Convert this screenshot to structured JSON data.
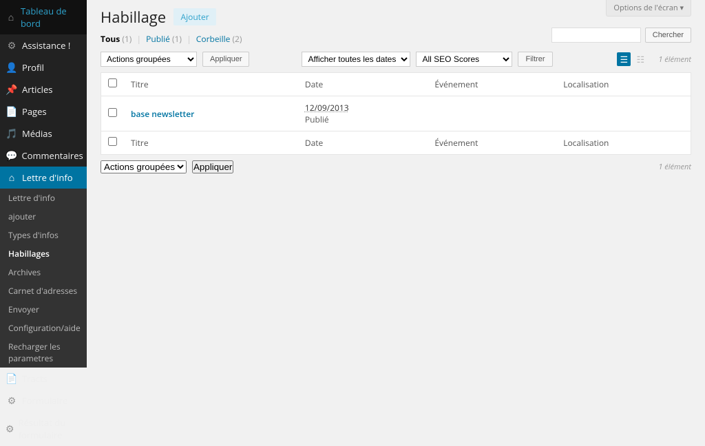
{
  "screenOptions": {
    "label": "Options de l'écran"
  },
  "sidebar": {
    "items": [
      {
        "label": "Tableau de bord",
        "icon": "dashboard"
      },
      {
        "label": "Assistance !",
        "icon": "gear"
      },
      {
        "label": "Profil",
        "icon": "user"
      },
      {
        "label": "Articles",
        "icon": "pin"
      },
      {
        "label": "Pages",
        "icon": "page"
      },
      {
        "label": "Médias",
        "icon": "media"
      },
      {
        "label": "Commentaires",
        "icon": "comment"
      },
      {
        "label": "Lettre d'info",
        "icon": "home",
        "current": true
      },
      {
        "label": "Tracts",
        "icon": "page"
      },
      {
        "label": "Formulaire",
        "icon": "gear"
      },
      {
        "label": "Résultat du formulaire",
        "icon": "gear"
      }
    ],
    "submenu": [
      {
        "label": "Lettre d'info"
      },
      {
        "label": "ajouter"
      },
      {
        "label": "Types d'infos"
      },
      {
        "label": "Habillages",
        "current": true
      },
      {
        "label": "Archives"
      },
      {
        "label": "Carnet d'adresses"
      },
      {
        "label": "Envoyer"
      },
      {
        "label": "Configuration/aide"
      },
      {
        "label": "Recharger les parametres"
      }
    ]
  },
  "page": {
    "title": "Habillage",
    "addNewLabel": "Ajouter"
  },
  "filters": {
    "all": {
      "label": "Tous",
      "count": "(1)"
    },
    "published": {
      "label": "Publié",
      "count": "(1)"
    },
    "trash": {
      "label": "Corbeille",
      "count": "(2)"
    }
  },
  "search": {
    "buttonLabel": "Chercher",
    "placeholder": ""
  },
  "bulk": {
    "actionsLabel": "Actions groupées",
    "applyLabel": "Appliquer",
    "datesLabel": "Afficher toutes les dates",
    "seoLabel": "All SEO Scores",
    "filterLabel": "Filtrer"
  },
  "table": {
    "columns": {
      "title": "Titre",
      "date": "Date",
      "event": "Événement",
      "location": "Localisation"
    },
    "rows": [
      {
        "title": "base newsletter",
        "date": "12/09/2013",
        "state": "Publié",
        "event": "",
        "location": ""
      }
    ],
    "countLabel": "1 élément"
  }
}
